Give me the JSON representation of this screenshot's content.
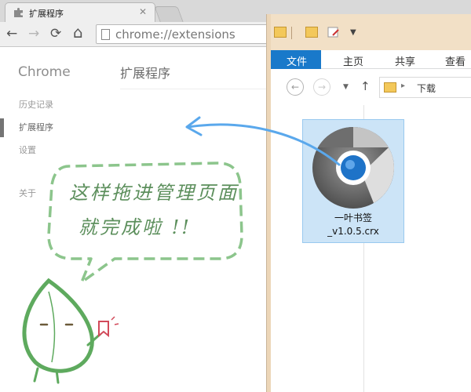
{
  "chrome": {
    "tab_title": "扩展程序",
    "tab_close": "✕",
    "nav_back": "←",
    "nav_forward": "→",
    "nav_reload": "⟳",
    "nav_home": "⌂",
    "url": "chrome://extensions",
    "brand": "Chrome",
    "page_title": "扩展程序",
    "sidebar": [
      "历史记录",
      "扩展程序",
      "设置",
      "关于"
    ]
  },
  "explorer": {
    "tabs": [
      "文件",
      "主页",
      "共享",
      "查看"
    ],
    "back": "←",
    "forward": "→",
    "dropdown": "▼",
    "up": "↑",
    "path_sep": "▸",
    "path": "下载",
    "file": {
      "line1": "一叶书签",
      "line2": "_v1.0.5.crx"
    }
  },
  "callout": {
    "line1": "这样拖进管理页面",
    "line2": "就完成啦 !!"
  },
  "colors": {
    "accent": "#1979ca",
    "selection": "#cce4f7",
    "arrow": "#5aa8ec",
    "mascot": "#5eaa5e",
    "bubble": "#8cc58c"
  }
}
